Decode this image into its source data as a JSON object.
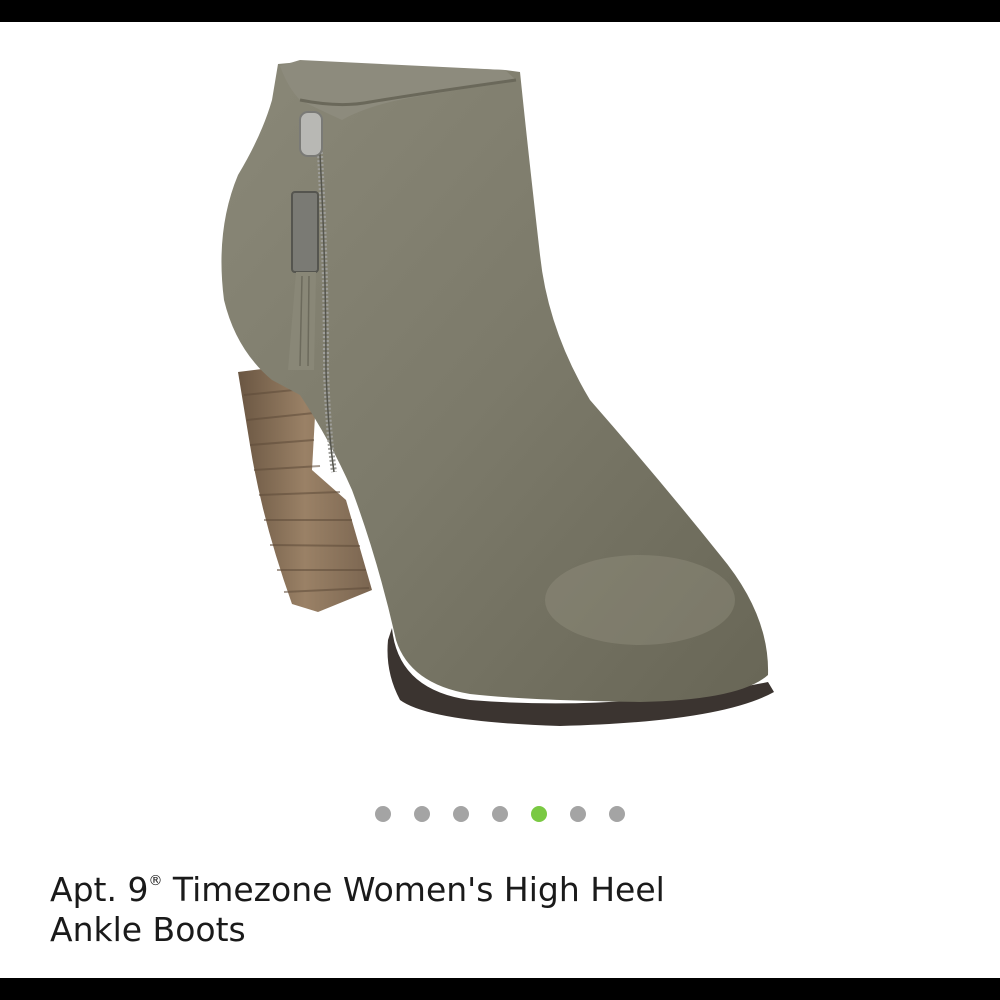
{
  "product": {
    "title_part1": "Apt. 9",
    "registered_mark": "®",
    "title_line1_rest": " Timezone Women's High Heel",
    "title_line2": "Ankle Boots",
    "image_icon": "ankle-boot-image"
  },
  "carousel": {
    "total": 7,
    "active_index": 4
  },
  "colors": {
    "dot": "#a4a4a4",
    "dot_active": "#7ac943",
    "bars": "#000000",
    "boot": "#7e7d6e",
    "heel": "#8c7359"
  }
}
